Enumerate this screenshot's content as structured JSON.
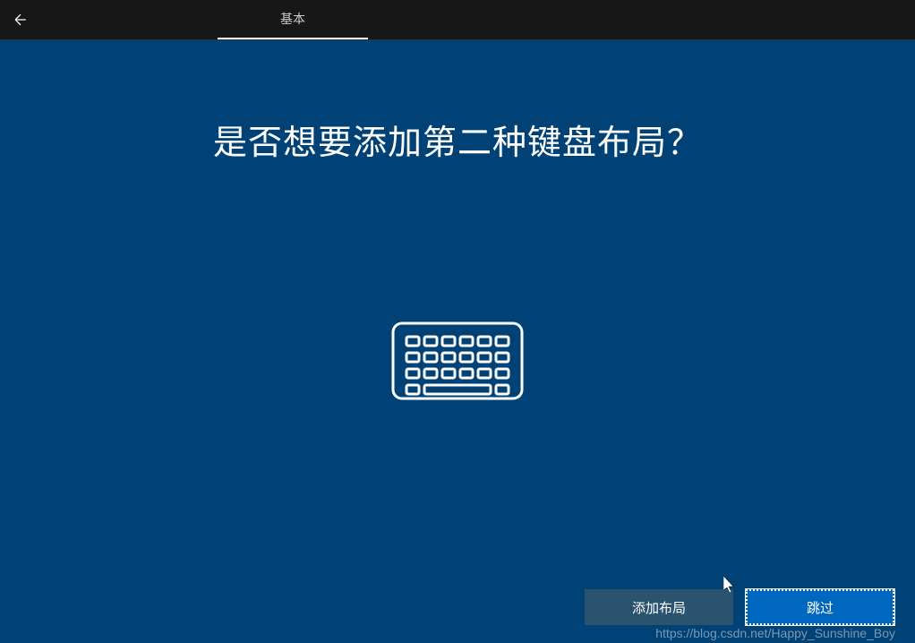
{
  "titlebar": {
    "tab_label": "基本"
  },
  "main": {
    "heading": "是否想要添加第二种键盘布局？"
  },
  "buttons": {
    "add_layout": "添加布局",
    "skip": "跳过"
  },
  "watermark": "https://blog.csdn.net/Happy_Sunshine_Boy",
  "colors": {
    "background": "#004275",
    "titlebar": "#171717",
    "btn_secondary": "#29536f",
    "btn_primary": "#0067c0"
  }
}
